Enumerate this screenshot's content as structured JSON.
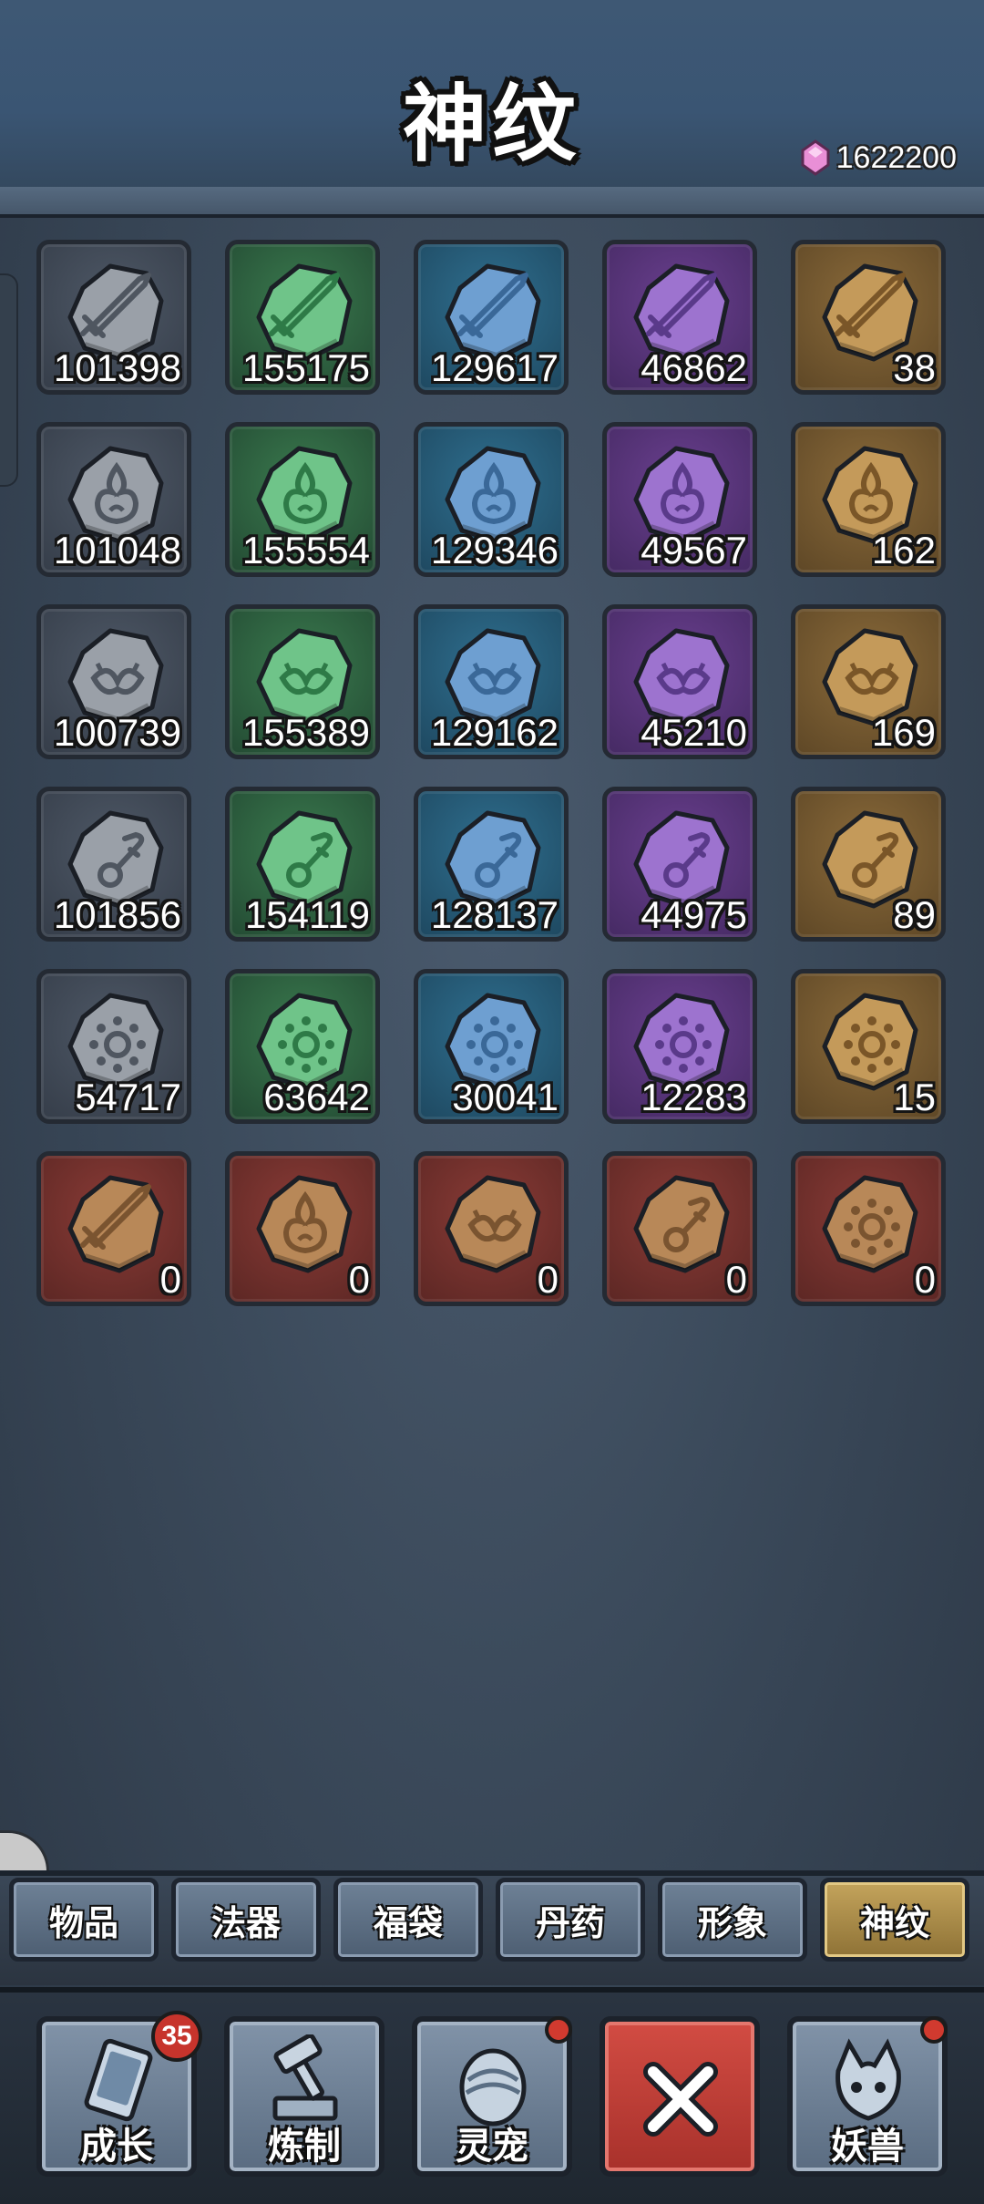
{
  "header": {
    "title": "神纹",
    "currency": {
      "icon": "pink-gem-icon",
      "value": "1622200"
    }
  },
  "colors": {
    "gray": "#4e5866",
    "green": "#3a7a4e",
    "blue": "#2f6f8f",
    "purple": "#6a3f8f",
    "gold": "#8a6a3a",
    "red": "#8a3b36"
  },
  "rune_grid": [
    {
      "rune": "sword-rune-icon",
      "cells": [
        {
          "quality": "gray",
          "count": "101398"
        },
        {
          "quality": "green",
          "count": "155175"
        },
        {
          "quality": "blue",
          "count": "129617"
        },
        {
          "quality": "purple",
          "count": "46862"
        },
        {
          "quality": "gold",
          "count": "38"
        }
      ]
    },
    {
      "rune": "flame-rune-icon",
      "cells": [
        {
          "quality": "gray",
          "count": "101048"
        },
        {
          "quality": "green",
          "count": "155554"
        },
        {
          "quality": "blue",
          "count": "129346"
        },
        {
          "quality": "purple",
          "count": "49567"
        },
        {
          "quality": "gold",
          "count": "162"
        }
      ]
    },
    {
      "rune": "wing-rune-icon",
      "cells": [
        {
          "quality": "gray",
          "count": "100739"
        },
        {
          "quality": "green",
          "count": "155389"
        },
        {
          "quality": "blue",
          "count": "129162"
        },
        {
          "quality": "purple",
          "count": "45210"
        },
        {
          "quality": "gold",
          "count": "169"
        }
      ]
    },
    {
      "rune": "key-rune-icon",
      "cells": [
        {
          "quality": "gray",
          "count": "101856"
        },
        {
          "quality": "green",
          "count": "154119"
        },
        {
          "quality": "blue",
          "count": "128137"
        },
        {
          "quality": "purple",
          "count": "44975"
        },
        {
          "quality": "gold",
          "count": "89"
        }
      ]
    },
    {
      "rune": "sun-rune-icon",
      "cells": [
        {
          "quality": "gray",
          "count": "54717"
        },
        {
          "quality": "green",
          "count": "63642"
        },
        {
          "quality": "blue",
          "count": "30041"
        },
        {
          "quality": "purple",
          "count": "12283"
        },
        {
          "quality": "gold",
          "count": "15"
        }
      ]
    },
    {
      "rune": "red-rune-set",
      "cells": [
        {
          "quality": "red",
          "rune": "sword-rune-icon",
          "count": "0"
        },
        {
          "quality": "red",
          "rune": "flame-rune-icon",
          "count": "0"
        },
        {
          "quality": "red",
          "rune": "wing-rune-icon",
          "count": "0"
        },
        {
          "quality": "red",
          "rune": "key-rune-icon",
          "count": "0"
        },
        {
          "quality": "red",
          "rune": "sun-rune-icon",
          "count": "0"
        }
      ]
    }
  ],
  "tabs": [
    {
      "label": "物品",
      "active": false
    },
    {
      "label": "法器",
      "active": false
    },
    {
      "label": "福袋",
      "active": false
    },
    {
      "label": "丹药",
      "active": false
    },
    {
      "label": "形象",
      "active": false
    },
    {
      "label": "神纹",
      "active": true
    }
  ],
  "nav": [
    {
      "label": "成长",
      "icon": "growth-card-icon",
      "badge": "35"
    },
    {
      "label": "炼制",
      "icon": "forge-hammer-icon",
      "dot": true
    },
    {
      "label": "灵宠",
      "icon": "pet-egg-icon",
      "dot": true
    },
    {
      "label": "",
      "icon": "close-x-icon"
    },
    {
      "label": "妖兽",
      "icon": "beast-icon",
      "dot": true
    }
  ]
}
